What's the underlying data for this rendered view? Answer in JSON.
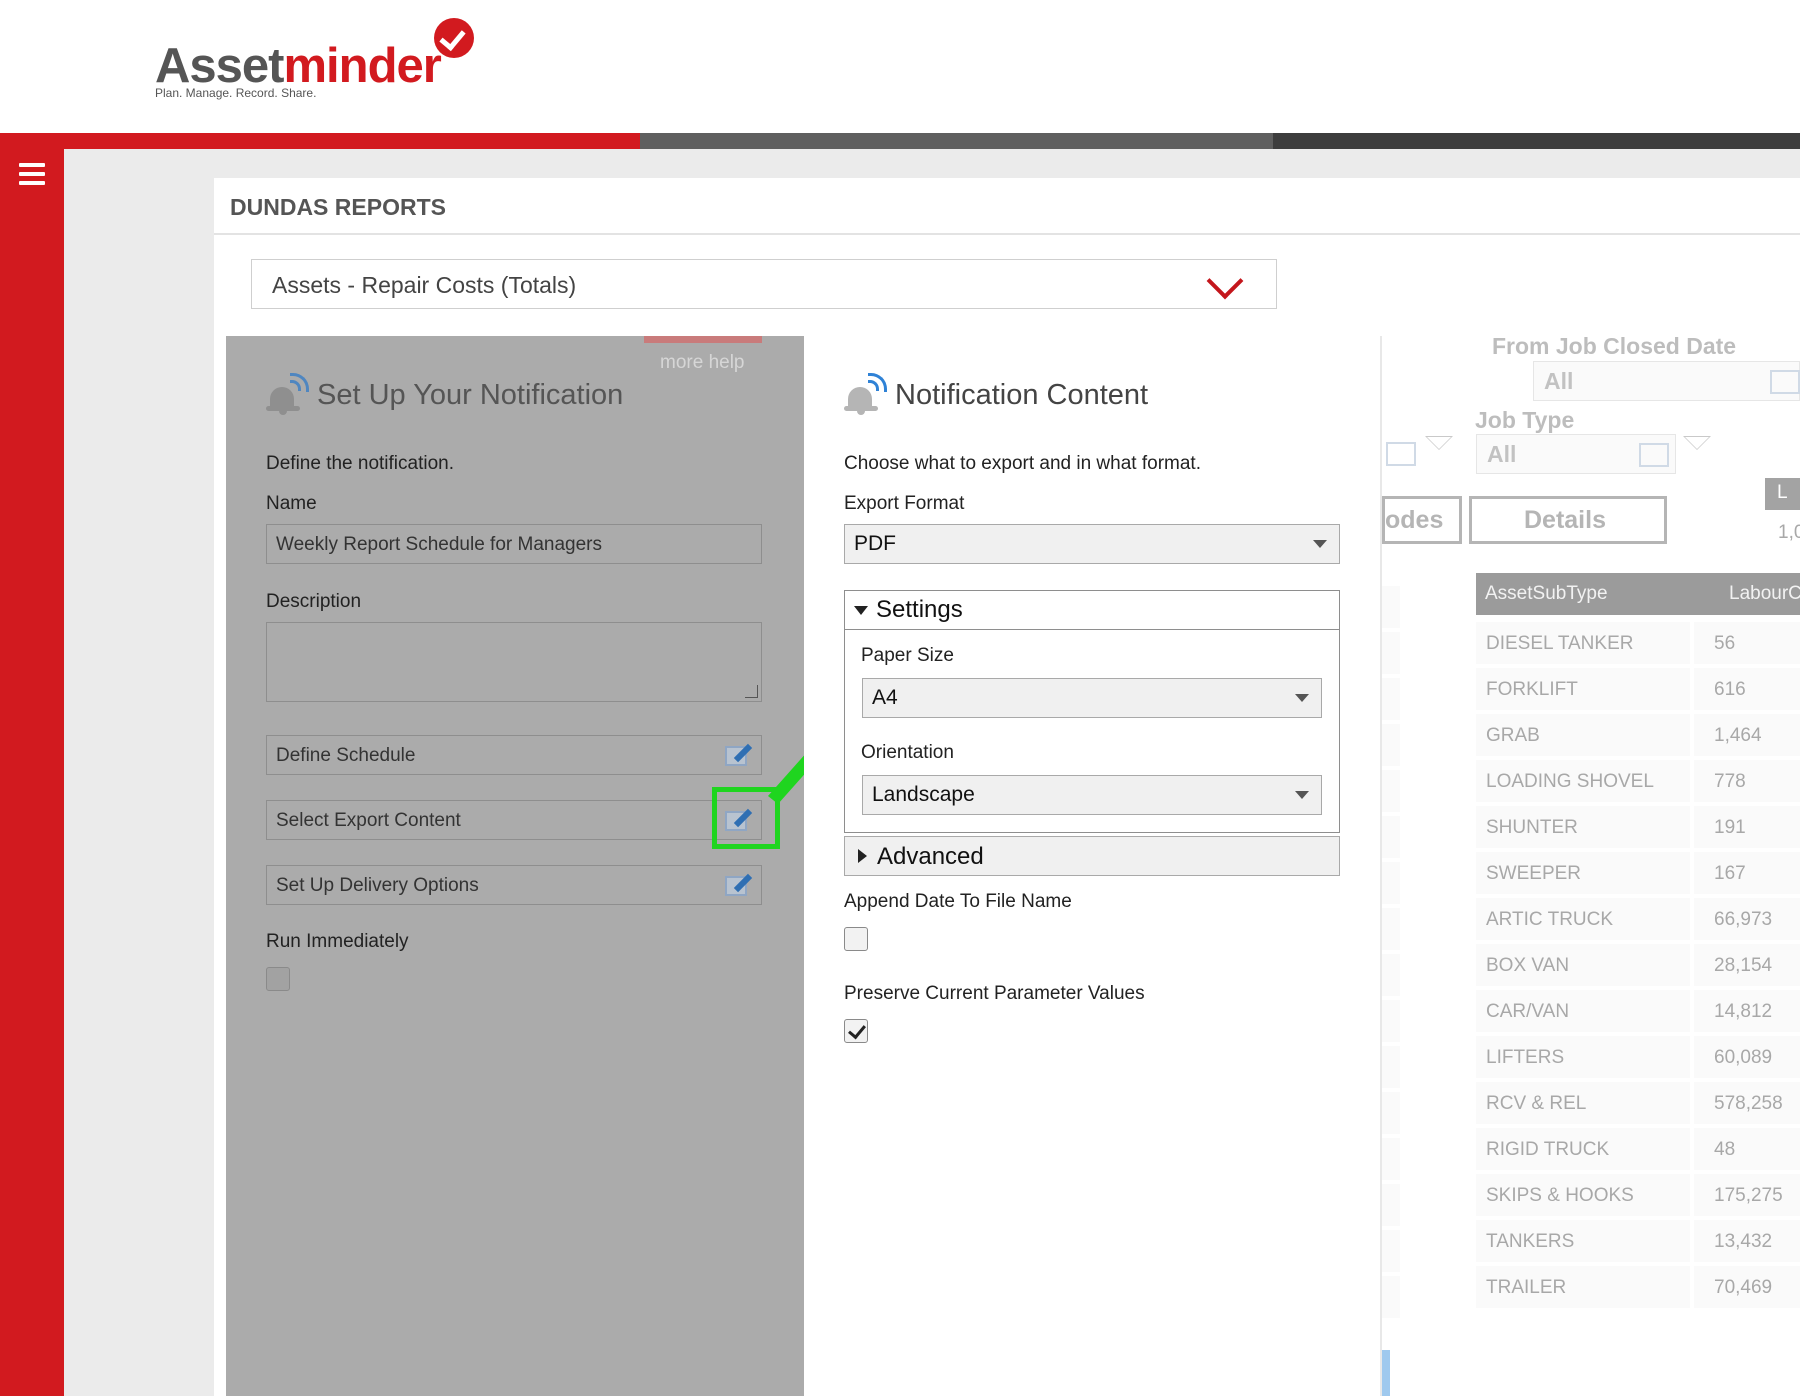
{
  "logo": {
    "brand_part1": "Asset",
    "brand_part2": "minder",
    "tagline": "Plan. Manage. Record. Share."
  },
  "menu": {
    "icon": "hamburger-icon"
  },
  "page": {
    "title": "DUNDAS REPORTS",
    "report_select_value": "Assets - Repair Costs (Totals)"
  },
  "colors": {
    "brand_red": "#d21a1f",
    "highlight_green": "#1fd51f",
    "panel_grey": "#ababab"
  },
  "setup_panel": {
    "more_help": "more help",
    "title": "Set Up Your Notification",
    "intro": "Define the notification.",
    "name_label": "Name",
    "name_value": "Weekly Report Schedule for Managers",
    "description_label": "Description",
    "description_value": "",
    "define_schedule": "Define Schedule",
    "select_export_content": "Select Export Content",
    "set_up_delivery": "Set Up Delivery Options",
    "run_immediately_label": "Run Immediately",
    "run_immediately_checked": false
  },
  "content_panel": {
    "title": "Notification Content",
    "intro": "Choose what to export and in what format.",
    "export_format_label": "Export Format",
    "export_format_value": "PDF",
    "settings_label": "Settings",
    "paper_size_label": "Paper Size",
    "paper_size_value": "A4",
    "orientation_label": "Orientation",
    "orientation_value": "Landscape",
    "advanced_label": "Advanced",
    "append_date_label": "Append Date To File Name",
    "append_date_checked": false,
    "preserve_params_label": "Preserve Current Parameter Values",
    "preserve_params_checked": true
  },
  "report_bg": {
    "from_job_closed_label": "From Job Closed Date",
    "from_job_closed_value": "All",
    "job_type_label": "Job Type",
    "job_type_value": "All",
    "codes_button": "odes",
    "details_button": "Details",
    "top_right_button": "L",
    "top_right_value": "1,0",
    "table_headers": [
      "AssetSubType",
      "LabourC"
    ],
    "table_rows": [
      {
        "name": "DIESEL TANKER",
        "value": "56"
      },
      {
        "name": "FORKLIFT",
        "value": "616"
      },
      {
        "name": "GRAB",
        "value": "1,464"
      },
      {
        "name": "LOADING SHOVEL",
        "value": "778"
      },
      {
        "name": "SHUNTER",
        "value": "191"
      },
      {
        "name": "SWEEPER",
        "value": "167"
      },
      {
        "name": "ARTIC TRUCK",
        "value": "66,973"
      },
      {
        "name": "BOX VAN",
        "value": "28,154"
      },
      {
        "name": "CAR/VAN",
        "value": "14,812"
      },
      {
        "name": "LIFTERS",
        "value": "60,089"
      },
      {
        "name": "RCV & REL",
        "value": "578,258"
      },
      {
        "name": "RIGID TRUCK",
        "value": "48"
      },
      {
        "name": "SKIPS & HOOKS",
        "value": "175,275"
      },
      {
        "name": "TANKERS",
        "value": "13,432"
      },
      {
        "name": "TRAILER",
        "value": "70,469"
      }
    ]
  }
}
